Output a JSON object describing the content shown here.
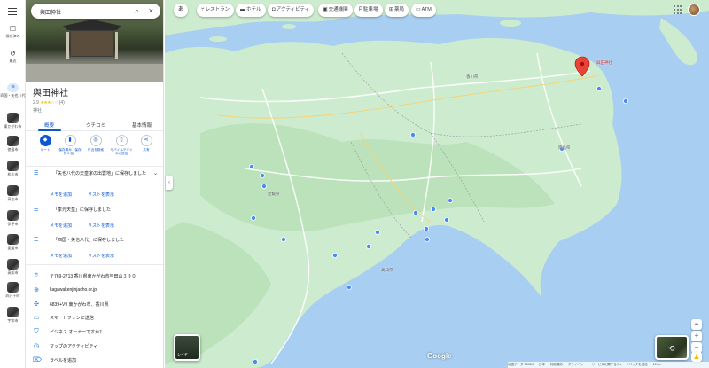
{
  "rail": {
    "menu_icon": "menu-icon",
    "items": [
      {
        "label": "保存済み",
        "icon": "bookmark-icon"
      },
      {
        "label": "最近",
        "icon": "history-icon"
      },
      {
        "label": "四国・矢也八代",
        "icon": "list-icon"
      },
      {
        "label": "東かがわ市"
      },
      {
        "label": "徳島市"
      },
      {
        "label": "松山市"
      },
      {
        "label": "高松市"
      },
      {
        "label": "伊予市"
      },
      {
        "label": "愛媛市"
      },
      {
        "label": "高知市"
      },
      {
        "label": "四万十町"
      },
      {
        "label": "宇和市"
      }
    ]
  },
  "search": {
    "value": "與田神社",
    "search_icon": "search-icon",
    "close_icon": "close-icon"
  },
  "place": {
    "title": "與田神社",
    "rating": "2.9",
    "stars": "★★★☆☆",
    "review_count": "(4)",
    "type": "神社"
  },
  "tabs": [
    {
      "label": "概要",
      "active": true
    },
    {
      "label": "クチコミ",
      "active": false
    },
    {
      "label": "基本情報",
      "active": false
    }
  ],
  "actions": [
    {
      "label": "ルート",
      "icon": "directions-icon"
    },
    {
      "label": "保存済み（保存先 3 個）",
      "icon": "saved-icon"
    },
    {
      "label": "付近を検索",
      "icon": "nearby-icon"
    },
    {
      "label": "モバイルデバイスに送信",
      "icon": "phone-icon"
    },
    {
      "label": "共有",
      "icon": "share-icon"
    }
  ],
  "saved_lists": [
    {
      "text": "「矢也八代の天皇家の出雲地」に保存しました",
      "memo": "メモを追加",
      "show": "リストを表示"
    },
    {
      "text": "「季元天皇」に保存しました",
      "memo": "メモを追加",
      "show": "リストを表示"
    },
    {
      "text": "「四国・矢也八代」に保存しました",
      "memo": "メモを追加",
      "show": "リストを表示"
    }
  ],
  "info": [
    {
      "text": "〒769-2713 香川県東かがわ市与田山３９０",
      "icon": "location-icon"
    },
    {
      "text": "kagawakenjinjacho.or.jp",
      "icon": "globe-icon"
    },
    {
      "text": "6839+V9 東かがわ市、香川県",
      "icon": "pluscode-icon"
    },
    {
      "text": "スマートフォンに送信",
      "icon": "phone-send-icon"
    },
    {
      "text": "ビジネス オーナーですか？",
      "icon": "shield-icon"
    },
    {
      "text": "マップのアクティビティ",
      "icon": "timeline-icon"
    },
    {
      "text": "ラベルを追加",
      "icon": "label-icon"
    }
  ],
  "map": {
    "lang_button": "あ",
    "chips": [
      {
        "label": "レストラン",
        "icon": "restaurant-icon"
      },
      {
        "label": "ホテル",
        "icon": "hotel-icon"
      },
      {
        "label": "アクティビティ",
        "icon": "camera-icon"
      },
      {
        "label": "交通機関",
        "icon": "transit-icon"
      },
      {
        "label": "駐車場",
        "icon": "parking-icon"
      },
      {
        "label": "薬局",
        "icon": "pharmacy-icon"
      },
      {
        "label": "ATM",
        "icon": "atm-icon"
      }
    ],
    "pin_label": "與田神社",
    "labels": [
      "香川県",
      "徳島県",
      "高知県",
      "愛媛県"
    ],
    "layer_label": "レイヤ",
    "logo": "Google",
    "footer": [
      "地図データ ©2024",
      "日本",
      "利用規約",
      "プライバシー",
      "サービスに関するフィードバックを送信",
      "10 km"
    ],
    "colors": {
      "land": "#cdeccf",
      "sea": "#a8cff2",
      "pin": "#ea4335",
      "accent": "#0b57d0"
    }
  }
}
